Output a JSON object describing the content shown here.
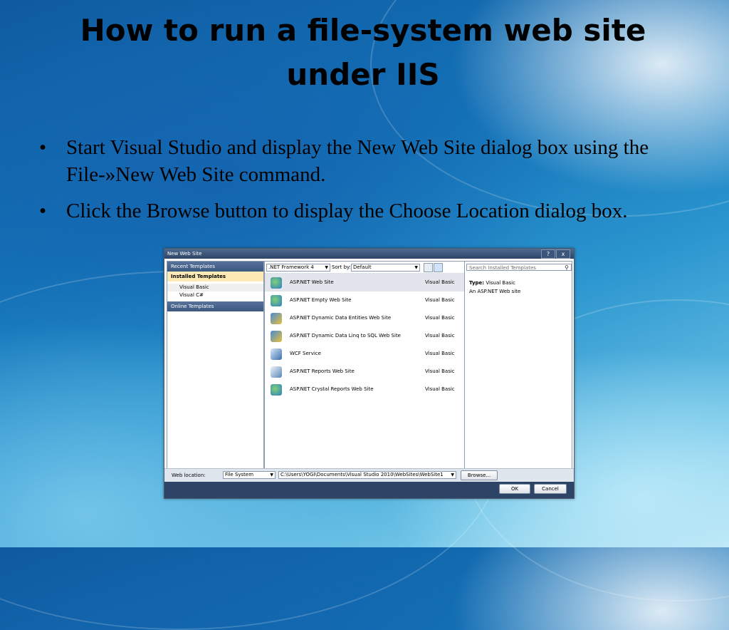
{
  "slide": {
    "title": "How to run a file-system web site under IIS",
    "bullets": [
      "Start Visual Studio and display the New Web Site dialog box using the File-»New Web Site command.",
      "Click the Browse button to display the Choose Location dialog box."
    ],
    "bullet_glyph": "•"
  },
  "dialog": {
    "title": "New Web Site",
    "help_label": "?",
    "close_label": "x",
    "left_pane": {
      "recent_templates": "Recent Templates",
      "installed_templates": "Installed Templates",
      "languages": [
        "Visual Basic",
        "Visual C#"
      ],
      "online_templates": "Online Templates"
    },
    "toolbar": {
      "framework": ".NET Framework 4",
      "sort_label": "Sort by:",
      "sort_value": "Default",
      "search_placeholder": "Search Installed Templates"
    },
    "templates": [
      {
        "name": "ASP.NET Web Site",
        "lang": "Visual Basic",
        "icon": "globe-icon"
      },
      {
        "name": "ASP.NET Empty Web Site",
        "lang": "Visual Basic",
        "icon": "globe-icon"
      },
      {
        "name": "ASP.NET Dynamic Data Entities Web Site",
        "lang": "Visual Basic",
        "icon": "data-icon"
      },
      {
        "name": "ASP.NET Dynamic Data Linq to SQL Web Site",
        "lang": "Visual Basic",
        "icon": "data-icon"
      },
      {
        "name": "WCF Service",
        "lang": "Visual Basic",
        "icon": "service-icon"
      },
      {
        "name": "ASP.NET Reports Web Site",
        "lang": "Visual Basic",
        "icon": "report-icon"
      },
      {
        "name": "ASP.NET Crystal Reports Web Site",
        "lang": "Visual Basic",
        "icon": "globe-icon"
      }
    ],
    "details": {
      "type_label": "Type:",
      "type_value": "Visual Basic",
      "description": "An ASP.NET Web site"
    },
    "bottom": {
      "web_location_label": "Web location:",
      "location_type": "File System",
      "path": "C:\\Users\\YOGI\\Documents\\Visual Studio 2010\\WebSites\\WebSite1",
      "browse_label": "Browse...",
      "ok_label": "OK",
      "cancel_label": "Cancel"
    },
    "colors": {
      "header_blue": "#3d5880",
      "selected_gold": "#fde9b4",
      "footer": "#2d4466"
    }
  }
}
